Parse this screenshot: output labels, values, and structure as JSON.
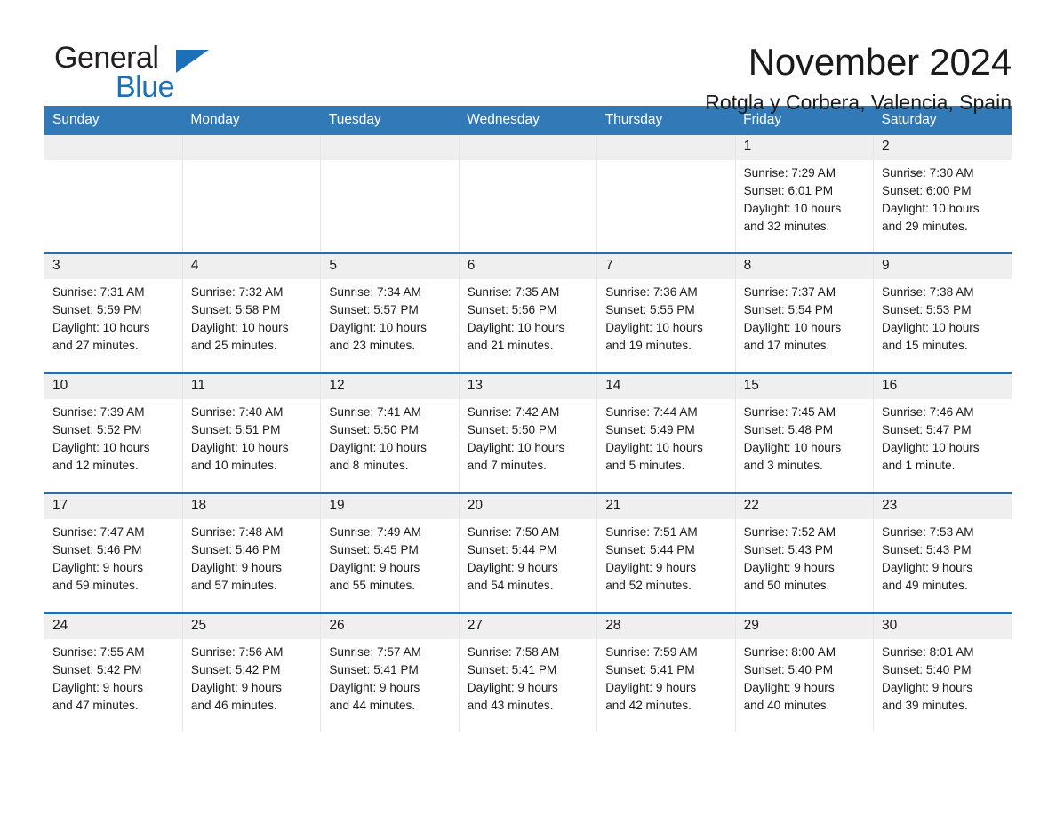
{
  "brand": {
    "name_part1": "General",
    "name_part2": "Blue",
    "logo_icon": "triangle-flag-icon",
    "accent_color": "#1c70b8"
  },
  "header": {
    "month_title": "November 2024",
    "location": "Rotgla y Corbera, Valencia, Spain"
  },
  "calendar": {
    "header_background": "#3279b7",
    "row_divider_color": "#2e6da4",
    "daynum_background": "#efefef",
    "weekdays": [
      "Sunday",
      "Monday",
      "Tuesday",
      "Wednesday",
      "Thursday",
      "Friday",
      "Saturday"
    ],
    "weeks": [
      [
        {
          "day": "",
          "sunrise": "",
          "sunset": "",
          "daylight_line1": "",
          "daylight_line2": ""
        },
        {
          "day": "",
          "sunrise": "",
          "sunset": "",
          "daylight_line1": "",
          "daylight_line2": ""
        },
        {
          "day": "",
          "sunrise": "",
          "sunset": "",
          "daylight_line1": "",
          "daylight_line2": ""
        },
        {
          "day": "",
          "sunrise": "",
          "sunset": "",
          "daylight_line1": "",
          "daylight_line2": ""
        },
        {
          "day": "",
          "sunrise": "",
          "sunset": "",
          "daylight_line1": "",
          "daylight_line2": ""
        },
        {
          "day": "1",
          "sunrise": "Sunrise: 7:29 AM",
          "sunset": "Sunset: 6:01 PM",
          "daylight_line1": "Daylight: 10 hours",
          "daylight_line2": "and 32 minutes."
        },
        {
          "day": "2",
          "sunrise": "Sunrise: 7:30 AM",
          "sunset": "Sunset: 6:00 PM",
          "daylight_line1": "Daylight: 10 hours",
          "daylight_line2": "and 29 minutes."
        }
      ],
      [
        {
          "day": "3",
          "sunrise": "Sunrise: 7:31 AM",
          "sunset": "Sunset: 5:59 PM",
          "daylight_line1": "Daylight: 10 hours",
          "daylight_line2": "and 27 minutes."
        },
        {
          "day": "4",
          "sunrise": "Sunrise: 7:32 AM",
          "sunset": "Sunset: 5:58 PM",
          "daylight_line1": "Daylight: 10 hours",
          "daylight_line2": "and 25 minutes."
        },
        {
          "day": "5",
          "sunrise": "Sunrise: 7:34 AM",
          "sunset": "Sunset: 5:57 PM",
          "daylight_line1": "Daylight: 10 hours",
          "daylight_line2": "and 23 minutes."
        },
        {
          "day": "6",
          "sunrise": "Sunrise: 7:35 AM",
          "sunset": "Sunset: 5:56 PM",
          "daylight_line1": "Daylight: 10 hours",
          "daylight_line2": "and 21 minutes."
        },
        {
          "day": "7",
          "sunrise": "Sunrise: 7:36 AM",
          "sunset": "Sunset: 5:55 PM",
          "daylight_line1": "Daylight: 10 hours",
          "daylight_line2": "and 19 minutes."
        },
        {
          "day": "8",
          "sunrise": "Sunrise: 7:37 AM",
          "sunset": "Sunset: 5:54 PM",
          "daylight_line1": "Daylight: 10 hours",
          "daylight_line2": "and 17 minutes."
        },
        {
          "day": "9",
          "sunrise": "Sunrise: 7:38 AM",
          "sunset": "Sunset: 5:53 PM",
          "daylight_line1": "Daylight: 10 hours",
          "daylight_line2": "and 15 minutes."
        }
      ],
      [
        {
          "day": "10",
          "sunrise": "Sunrise: 7:39 AM",
          "sunset": "Sunset: 5:52 PM",
          "daylight_line1": "Daylight: 10 hours",
          "daylight_line2": "and 12 minutes."
        },
        {
          "day": "11",
          "sunrise": "Sunrise: 7:40 AM",
          "sunset": "Sunset: 5:51 PM",
          "daylight_line1": "Daylight: 10 hours",
          "daylight_line2": "and 10 minutes."
        },
        {
          "day": "12",
          "sunrise": "Sunrise: 7:41 AM",
          "sunset": "Sunset: 5:50 PM",
          "daylight_line1": "Daylight: 10 hours",
          "daylight_line2": "and 8 minutes."
        },
        {
          "day": "13",
          "sunrise": "Sunrise: 7:42 AM",
          "sunset": "Sunset: 5:50 PM",
          "daylight_line1": "Daylight: 10 hours",
          "daylight_line2": "and 7 minutes."
        },
        {
          "day": "14",
          "sunrise": "Sunrise: 7:44 AM",
          "sunset": "Sunset: 5:49 PM",
          "daylight_line1": "Daylight: 10 hours",
          "daylight_line2": "and 5 minutes."
        },
        {
          "day": "15",
          "sunrise": "Sunrise: 7:45 AM",
          "sunset": "Sunset: 5:48 PM",
          "daylight_line1": "Daylight: 10 hours",
          "daylight_line2": "and 3 minutes."
        },
        {
          "day": "16",
          "sunrise": "Sunrise: 7:46 AM",
          "sunset": "Sunset: 5:47 PM",
          "daylight_line1": "Daylight: 10 hours",
          "daylight_line2": "and 1 minute."
        }
      ],
      [
        {
          "day": "17",
          "sunrise": "Sunrise: 7:47 AM",
          "sunset": "Sunset: 5:46 PM",
          "daylight_line1": "Daylight: 9 hours",
          "daylight_line2": "and 59 minutes."
        },
        {
          "day": "18",
          "sunrise": "Sunrise: 7:48 AM",
          "sunset": "Sunset: 5:46 PM",
          "daylight_line1": "Daylight: 9 hours",
          "daylight_line2": "and 57 minutes."
        },
        {
          "day": "19",
          "sunrise": "Sunrise: 7:49 AM",
          "sunset": "Sunset: 5:45 PM",
          "daylight_line1": "Daylight: 9 hours",
          "daylight_line2": "and 55 minutes."
        },
        {
          "day": "20",
          "sunrise": "Sunrise: 7:50 AM",
          "sunset": "Sunset: 5:44 PM",
          "daylight_line1": "Daylight: 9 hours",
          "daylight_line2": "and 54 minutes."
        },
        {
          "day": "21",
          "sunrise": "Sunrise: 7:51 AM",
          "sunset": "Sunset: 5:44 PM",
          "daylight_line1": "Daylight: 9 hours",
          "daylight_line2": "and 52 minutes."
        },
        {
          "day": "22",
          "sunrise": "Sunrise: 7:52 AM",
          "sunset": "Sunset: 5:43 PM",
          "daylight_line1": "Daylight: 9 hours",
          "daylight_line2": "and 50 minutes."
        },
        {
          "day": "23",
          "sunrise": "Sunrise: 7:53 AM",
          "sunset": "Sunset: 5:43 PM",
          "daylight_line1": "Daylight: 9 hours",
          "daylight_line2": "and 49 minutes."
        }
      ],
      [
        {
          "day": "24",
          "sunrise": "Sunrise: 7:55 AM",
          "sunset": "Sunset: 5:42 PM",
          "daylight_line1": "Daylight: 9 hours",
          "daylight_line2": "and 47 minutes."
        },
        {
          "day": "25",
          "sunrise": "Sunrise: 7:56 AM",
          "sunset": "Sunset: 5:42 PM",
          "daylight_line1": "Daylight: 9 hours",
          "daylight_line2": "and 46 minutes."
        },
        {
          "day": "26",
          "sunrise": "Sunrise: 7:57 AM",
          "sunset": "Sunset: 5:41 PM",
          "daylight_line1": "Daylight: 9 hours",
          "daylight_line2": "and 44 minutes."
        },
        {
          "day": "27",
          "sunrise": "Sunrise: 7:58 AM",
          "sunset": "Sunset: 5:41 PM",
          "daylight_line1": "Daylight: 9 hours",
          "daylight_line2": "and 43 minutes."
        },
        {
          "day": "28",
          "sunrise": "Sunrise: 7:59 AM",
          "sunset": "Sunset: 5:41 PM",
          "daylight_line1": "Daylight: 9 hours",
          "daylight_line2": "and 42 minutes."
        },
        {
          "day": "29",
          "sunrise": "Sunrise: 8:00 AM",
          "sunset": "Sunset: 5:40 PM",
          "daylight_line1": "Daylight: 9 hours",
          "daylight_line2": "and 40 minutes."
        },
        {
          "day": "30",
          "sunrise": "Sunrise: 8:01 AM",
          "sunset": "Sunset: 5:40 PM",
          "daylight_line1": "Daylight: 9 hours",
          "daylight_line2": "and 39 minutes."
        }
      ]
    ]
  }
}
